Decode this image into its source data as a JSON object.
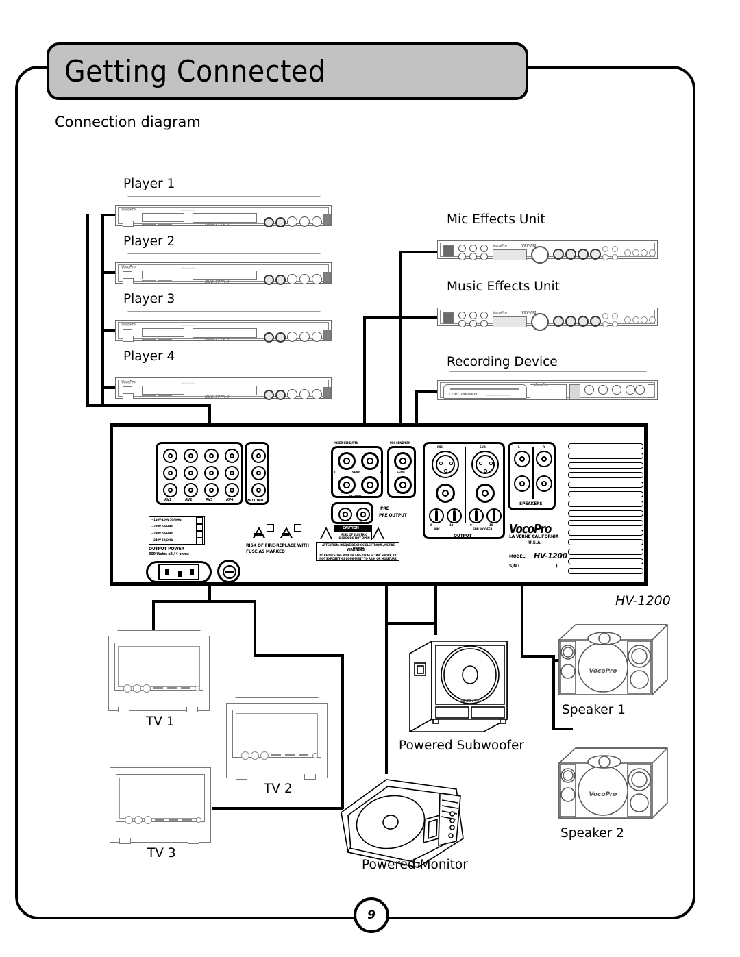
{
  "header": {
    "title": "Getting Connected",
    "subtitle": "Connection diagram"
  },
  "page_number": "9",
  "devices": {
    "players": [
      {
        "label": "Player 1",
        "brand": "VocoPro",
        "model": "DVG-777K II"
      },
      {
        "label": "Player 2",
        "brand": "VocoPro",
        "model": "DVG-777K II"
      },
      {
        "label": "Player 3",
        "brand": "VocoPro",
        "model": "DVG-777K II"
      },
      {
        "label": "Player 4",
        "brand": "VocoPro",
        "model": "DVG-777K II"
      }
    ],
    "mic_effects": {
      "label": "Mic Effects Unit",
      "brand": "VocoPro",
      "model": "VEF-M1"
    },
    "music_effects": {
      "label": "Music Effects Unit",
      "brand": "VocoPro",
      "model": "VEF-M1"
    },
    "recorder": {
      "label": "Recording Device",
      "brand": "VocoPro",
      "model": "CDR-1000PRO",
      "sub": "CD RECORDER / CD PLAYER"
    },
    "subwoofer": {
      "label": "Powered Subwoofer",
      "brand": "VocoPro"
    },
    "monitor": {
      "label": "Powered Monitor"
    },
    "speakers": [
      {
        "label": "Speaker 1",
        "brand": "VocoPro"
      },
      {
        "label": "Speaker 2",
        "brand": "VocoPro"
      }
    ],
    "tvs": [
      {
        "label": "TV 1"
      },
      {
        "label": "TV 2"
      },
      {
        "label": "TV 3"
      }
    ]
  },
  "amplifier": {
    "caption": "HV-1200",
    "brand": "VocoPro",
    "brand_line1": "LA VERNE CALIFORNIA",
    "brand_line2": "U.S.A.",
    "model_label": "MODEL:",
    "model_value": "HV-1200",
    "serial_label": "S/N (",
    "serial_close": ")",
    "av_inputs": [
      "AV1",
      "AV2",
      "AV3",
      "AV4"
    ],
    "av_output_label": "AV OUTPUT",
    "mixer_send_label": "MIXER SEND/RTN",
    "mic_send_label": "MIC SEND/RTN",
    "send_label": "SEND",
    "return_label": "RETURN",
    "left_label": "L",
    "right_label": "R",
    "pre_output_label": "PRE OUTPUT",
    "mic_out_label": "MIC",
    "sub_out_label": "SUB",
    "output_label": "OUTPUT",
    "out_knob_mic": "MIC",
    "out_knob_sub": "SUB WOOFER",
    "knob_min": "0",
    "knob_max": "10",
    "speakers_label": "SPEAKERS",
    "voltage_options": [
      "~110V-120V 50/60Hz",
      "~220V 50/60Hz",
      "~230V 50/60Hz",
      "~240V 50/60Hz"
    ],
    "output_power_label": "OUTPUT POWER",
    "output_power_value": "300 Watts x2 / 4 ohms",
    "ac_input_label": "~AC INPUT",
    "ac_fuse_label": "AC FUSE",
    "fuse_warning": "RISK OF FIRE-REPLACE WITH FUSE AS MARKED",
    "caution_title": "CAUTION",
    "caution_body": "RISK OF ELECTRIC SHOCK DO NOT OPEN",
    "attention_line": "ATTENTION: RISQUE DE CHOC ELECTRIQUE, NE PAS OUVRIR",
    "warning_title": "WARNING",
    "warning_body": "TO REDUCE THE RISK OF FIRE OR ELECTRIC SHOCK, DO NOT EXPOSE THIS EQUIPMENT TO RAIN OR MOISTURE."
  },
  "colors": {
    "banner": "#c2c2c2",
    "line": "#000000",
    "device_outline": "#6e6e6e"
  }
}
